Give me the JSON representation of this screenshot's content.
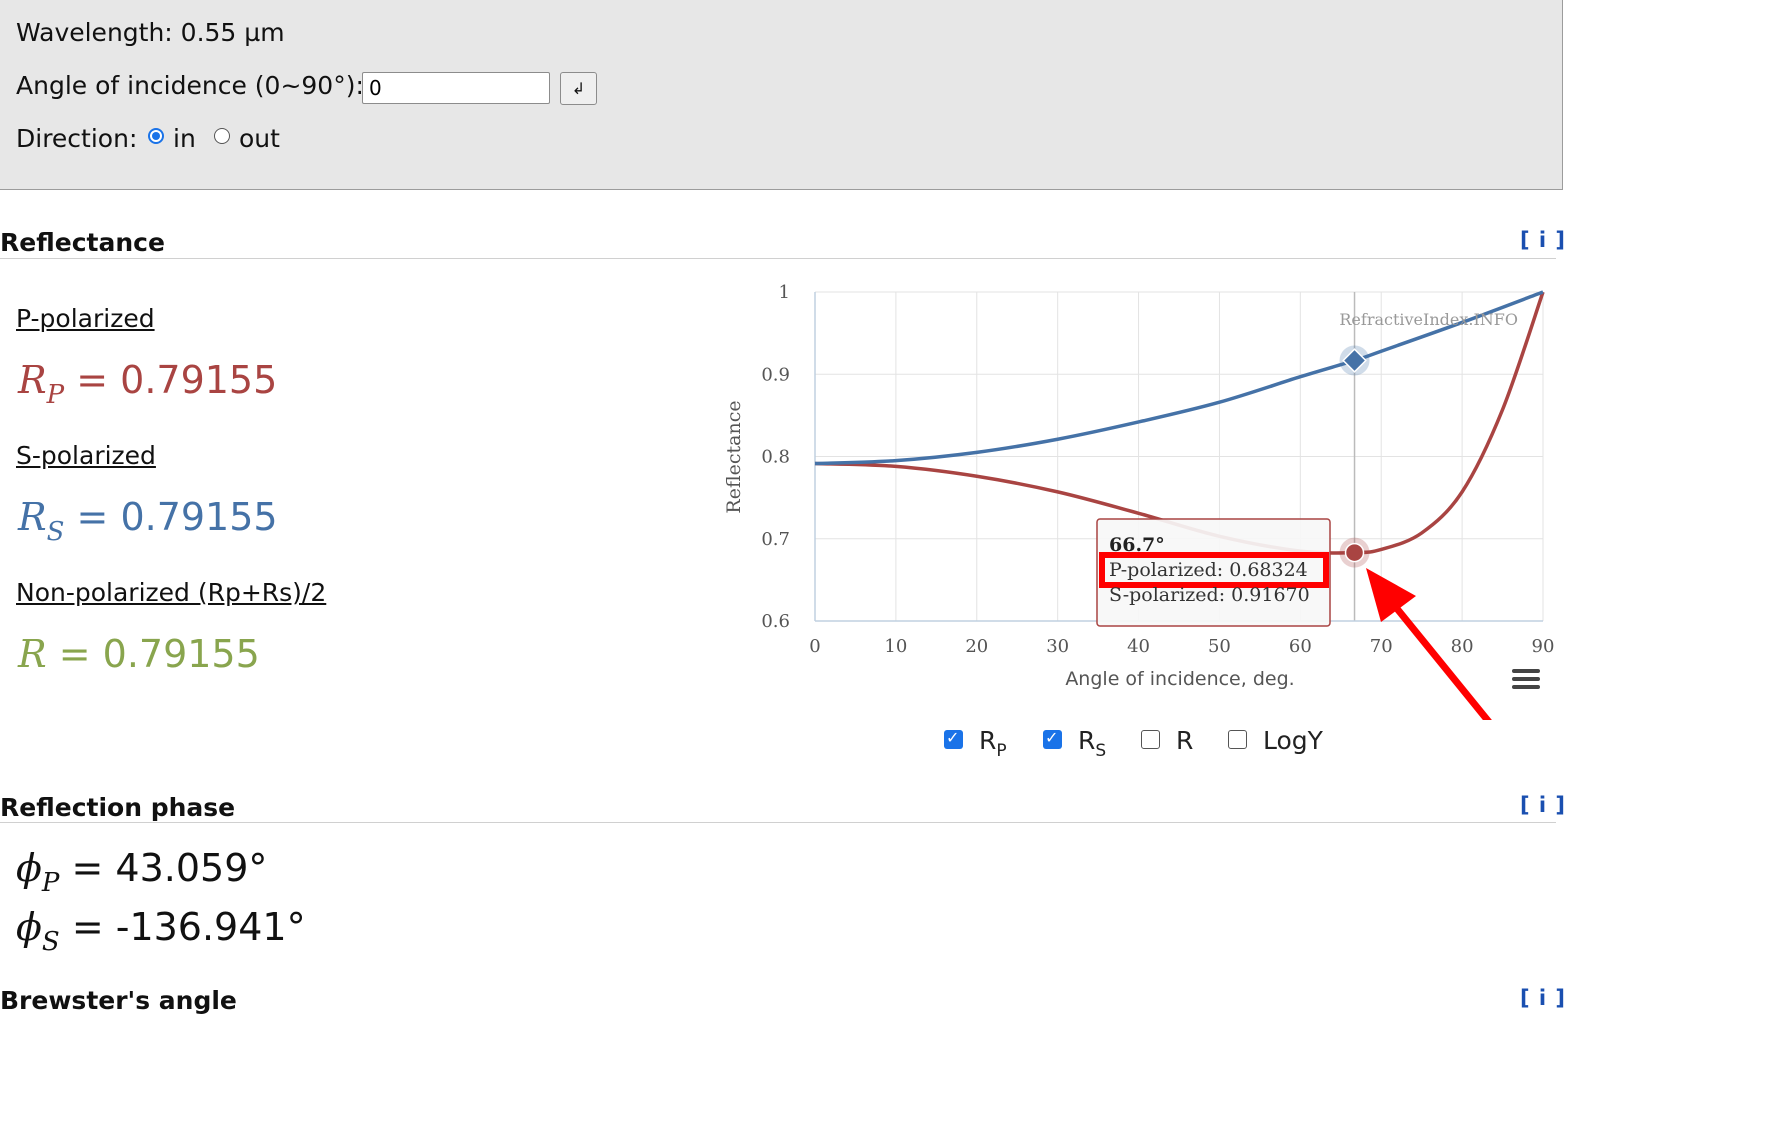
{
  "controls": {
    "wavelength_label": "Wavelength: 0.55 µm",
    "angle_label": "Angle of incidence (0~90°):",
    "angle_value": "0",
    "enter_label": "↲",
    "direction_label": "Direction:",
    "direction_in": "in",
    "direction_out": "out",
    "direction_selected": "in"
  },
  "reflectance": {
    "title": "Reflectance",
    "info": "[ i ]",
    "p_label": "P-polarized",
    "p_symbol": "R",
    "p_sub": "P",
    "p_value": "= 0.79155",
    "s_label": "S-polarized",
    "s_symbol": "R",
    "s_sub": "S",
    "s_value": "= 0.79155",
    "n_label": "Non-polarized (Rp+Rs)/2",
    "n_symbol": "R",
    "n_value": "= 0.79155",
    "colors": {
      "p": "#a94442",
      "s": "#4572a7",
      "n": "#89a54e"
    }
  },
  "chart_data": {
    "type": "line",
    "xlabel": "Angle of incidence, deg.",
    "ylabel": "Reflectance",
    "xlim": [
      0,
      90
    ],
    "ylim": [
      0.6,
      1
    ],
    "xticks": [
      "0",
      "10",
      "20",
      "30",
      "40",
      "50",
      "60",
      "70",
      "80",
      "90"
    ],
    "yticks": [
      "0.6",
      "0.7",
      "0.8",
      "0.9",
      "1"
    ],
    "credit": "RefractiveIndex.INFO",
    "grid": true,
    "series": [
      {
        "name": "RP",
        "color": "#a94442",
        "x": [
          0,
          10,
          20,
          30,
          40,
          50,
          60,
          66.7,
          70,
          75,
          80,
          85,
          90
        ],
        "y": [
          0.7915,
          0.788,
          0.776,
          0.757,
          0.731,
          0.703,
          0.685,
          0.6832,
          0.687,
          0.707,
          0.757,
          0.857,
          1.0
        ]
      },
      {
        "name": "RS",
        "color": "#4572a7",
        "x": [
          0,
          10,
          20,
          30,
          40,
          50,
          60,
          66.7,
          70,
          80,
          90
        ],
        "y": [
          0.7915,
          0.795,
          0.805,
          0.821,
          0.842,
          0.866,
          0.897,
          0.9167,
          0.928,
          0.963,
          1.0
        ]
      }
    ],
    "tooltip": {
      "x": 66.7,
      "title": "66.7°",
      "line_p": "P-polarized: 0.68324",
      "line_s": "S-polarized: 0.91670"
    },
    "legend_items": [
      {
        "label": "R",
        "sub": "P",
        "checked": true
      },
      {
        "label": "R",
        "sub": "S",
        "checked": true
      },
      {
        "label": "R",
        "sub": "",
        "checked": false
      },
      {
        "label": "LogY",
        "sub": "",
        "checked": false
      }
    ]
  },
  "phase": {
    "title": "Reflection phase",
    "info": "[ i ]",
    "p_symbol": "ϕ",
    "p_sub": "P",
    "p_value": "= 43.059°",
    "s_symbol": "ϕ",
    "s_sub": "S",
    "s_value": "= -136.941°"
  },
  "brewster": {
    "title": "Brewster's angle",
    "info": "[ i ]"
  }
}
